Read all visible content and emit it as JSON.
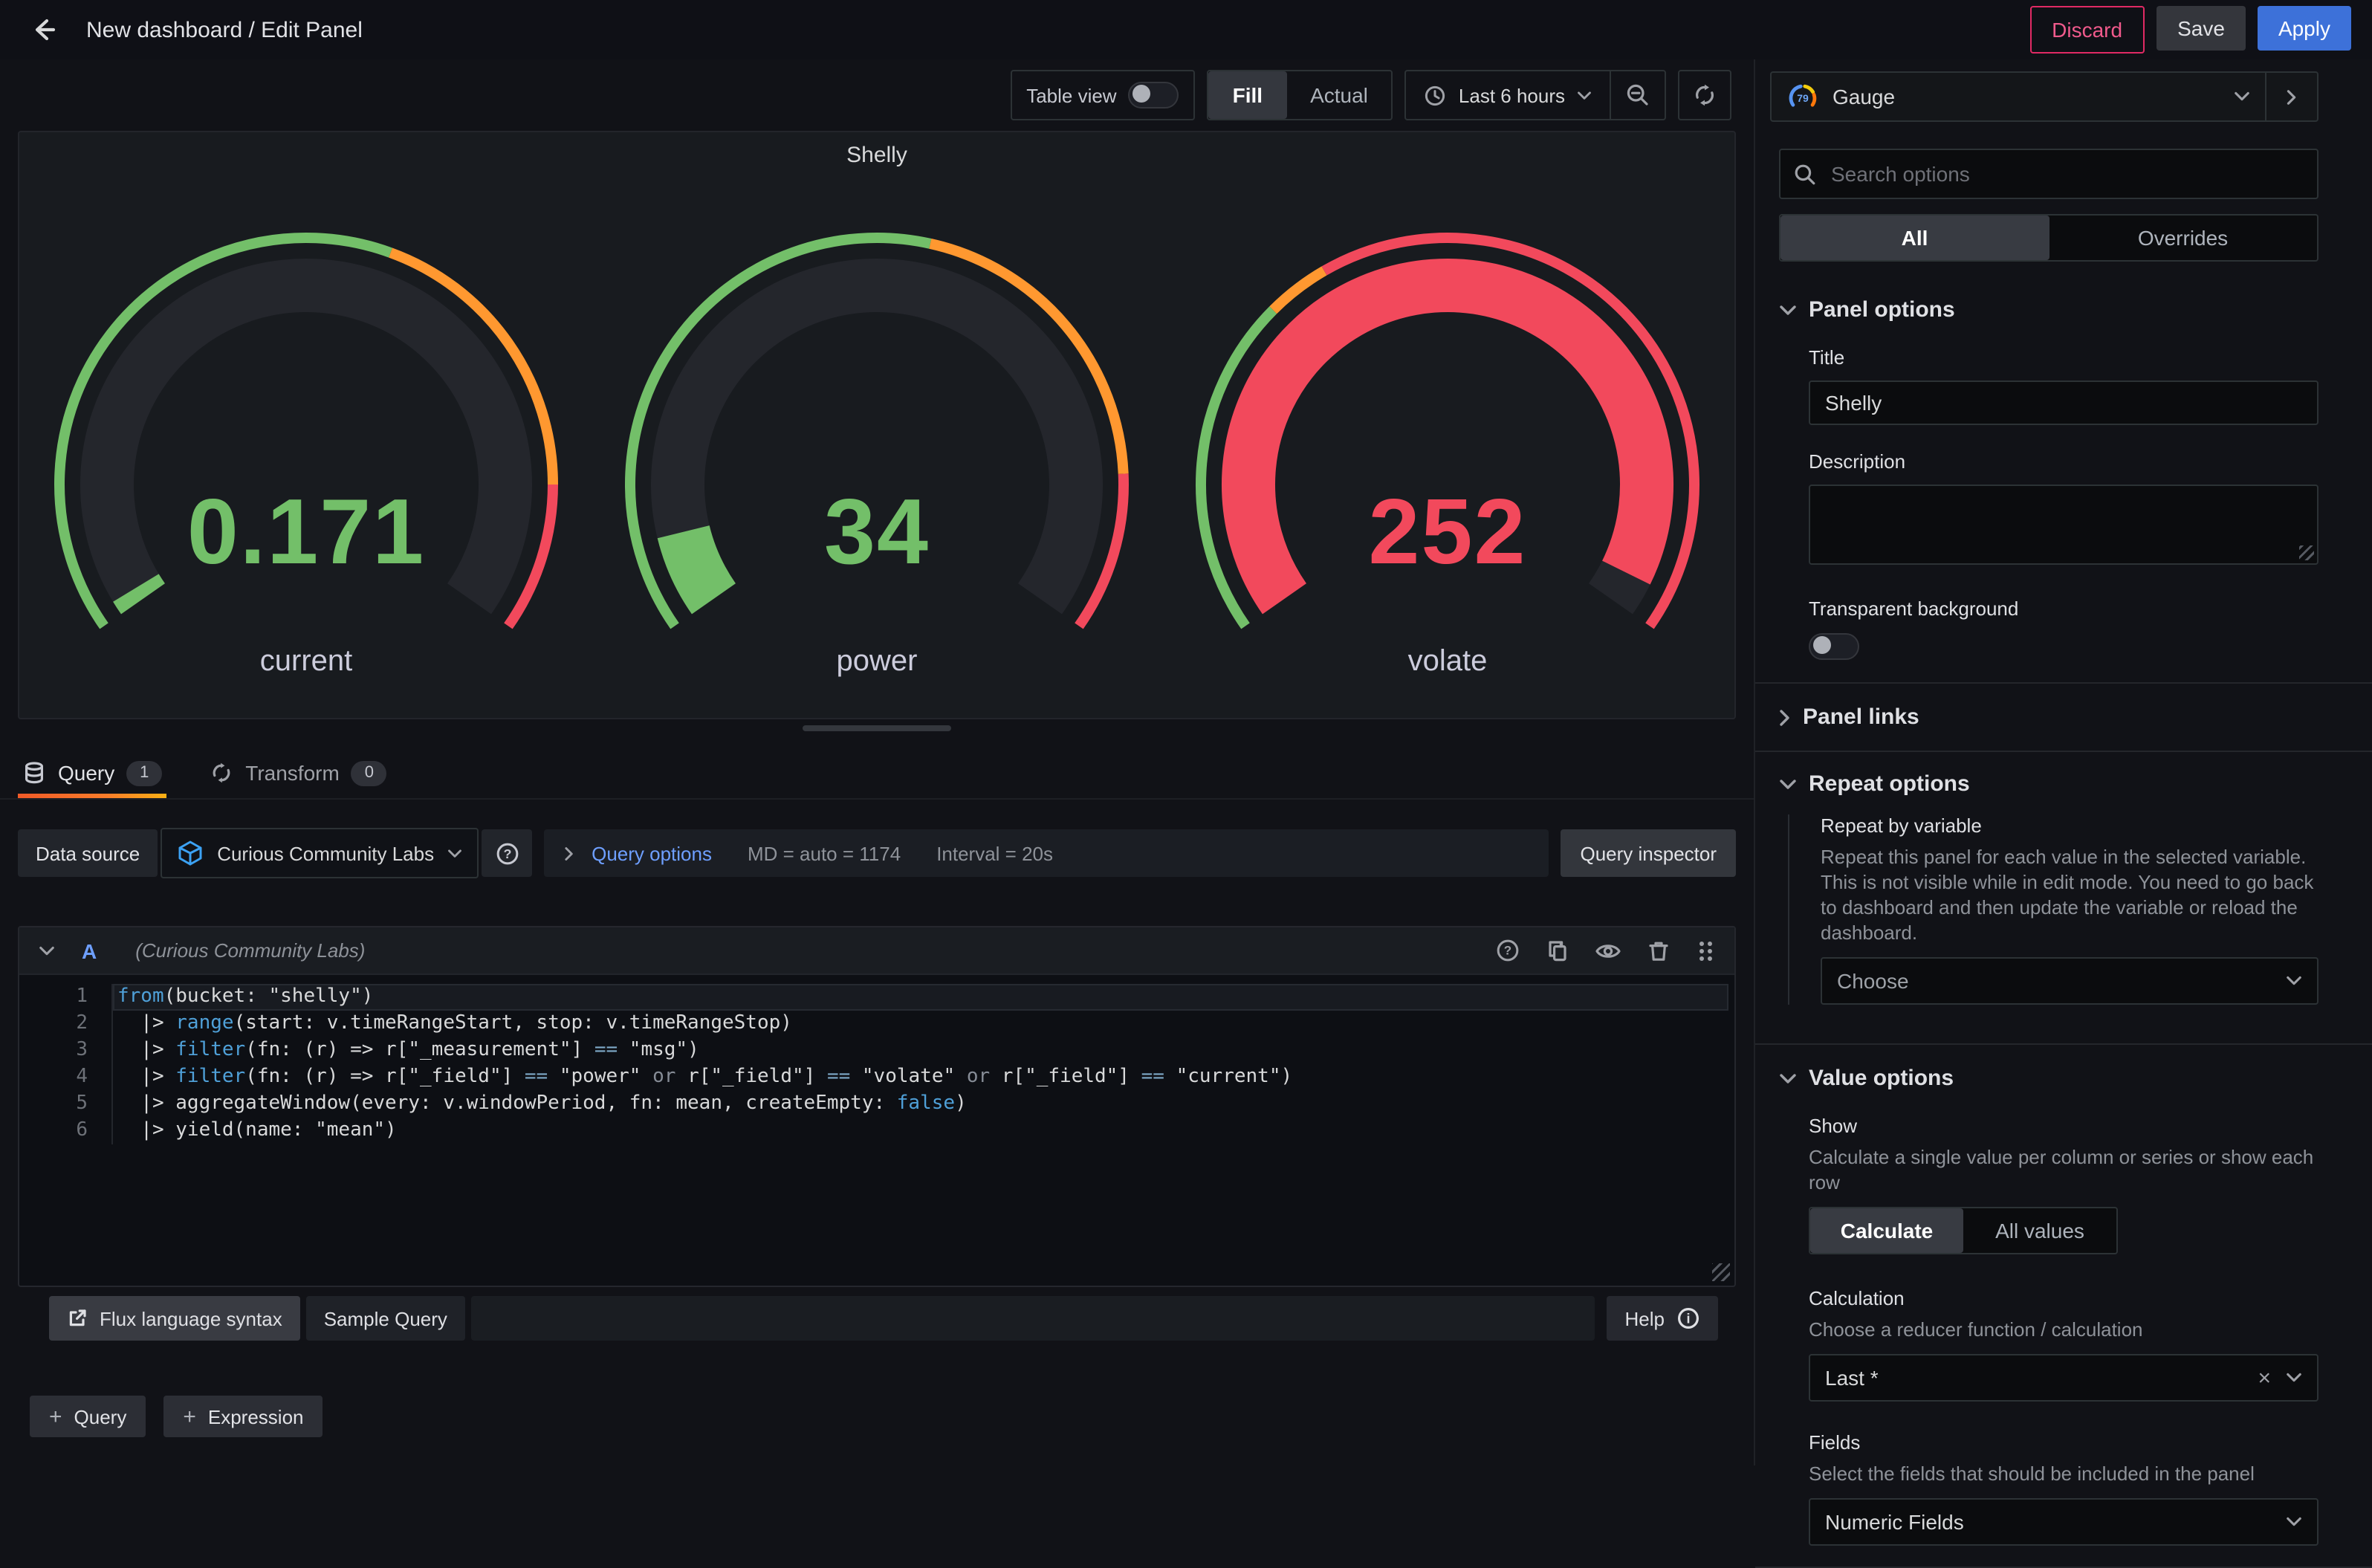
{
  "topbar": {
    "title": "New dashboard / Edit Panel",
    "discard_label": "Discard",
    "save_label": "Save",
    "apply_label": "Apply"
  },
  "viewport_toolbar": {
    "table_view_label": "Table view",
    "fill_label": "Fill",
    "actual_label": "Actual",
    "time_range_label": "Last 6 hours"
  },
  "colors": {
    "accent_blue": "#3d71d9",
    "link_blue": "#6e9fff",
    "success_green": "#73bf69",
    "warning_orange": "#ff9830",
    "critical_red": "#f2495c",
    "tab_underline_start": "#f05a28",
    "tab_underline_end": "#fbca0a"
  },
  "panel": {
    "title": "Shelly",
    "gauges": [
      {
        "label": "current",
        "value": "0.171",
        "color": "#73bf69",
        "fraction": 0.015,
        "ring": [
          {
            "to": 0.58,
            "color": "#73bf69"
          },
          {
            "to": 0.86,
            "color": "#ff9830"
          },
          {
            "to": 1,
            "color": "#f2495c"
          }
        ]
      },
      {
        "label": "power",
        "value": "34",
        "color": "#73bf69",
        "fraction": 0.085,
        "ring": [
          {
            "to": 0.55,
            "color": "#73bf69"
          },
          {
            "to": 0.85,
            "color": "#ff9830"
          },
          {
            "to": 1,
            "color": "#f2495c"
          }
        ]
      },
      {
        "label": "volate",
        "value": "252",
        "color": "#f2495c",
        "fraction": 0.965,
        "ring": [
          {
            "to": 0.32,
            "color": "#73bf69"
          },
          {
            "to": 0.38,
            "color": "#ff9830"
          },
          {
            "to": 1,
            "color": "#f2495c"
          }
        ]
      }
    ]
  },
  "query_section": {
    "tabs": [
      {
        "label": "Query",
        "count": "1"
      },
      {
        "label": "Transform",
        "count": "0"
      }
    ],
    "datasource_row": {
      "label": "Data source",
      "datasource_name": "Curious Community Labs",
      "query_options_label": "Query options",
      "md_info": "MD = auto = 1174",
      "interval_info": "Interval = 20s",
      "inspector_label": "Query inspector"
    },
    "query_card": {
      "ref_id": "A",
      "datasource_note": "(Curious Community Labs)"
    },
    "code": {
      "lines": [
        {
          "n": "1",
          "hl": true,
          "t": [
            [
              "kw",
              "from"
            ],
            [
              "pl",
              "(bucket: \"shelly\")"
            ]
          ]
        },
        {
          "n": "2",
          "hl": false,
          "t": [
            [
              "pl",
              "  |> "
            ],
            [
              "kw",
              "range"
            ],
            [
              "pl",
              "(start: v.timeRangeStart, stop: v.timeRangeStop)"
            ]
          ]
        },
        {
          "n": "3",
          "hl": false,
          "t": [
            [
              "pl",
              "  |> "
            ],
            [
              "kw",
              "filter"
            ],
            [
              "pl",
              "(fn: (r) => r[\"_measurement\"] "
            ],
            [
              "op",
              "=="
            ],
            [
              "pl",
              " \"msg\")"
            ]
          ]
        },
        {
          "n": "4",
          "hl": false,
          "t": [
            [
              "pl",
              "  |> "
            ],
            [
              "kw",
              "filter"
            ],
            [
              "pl",
              "(fn: (r) => r[\"_field\"] "
            ],
            [
              "op",
              "=="
            ],
            [
              "pl",
              " \"power\" "
            ],
            [
              "or",
              "or"
            ],
            [
              "pl",
              " r[\"_field\"] "
            ],
            [
              "op",
              "=="
            ],
            [
              "pl",
              " \"volate\" "
            ],
            [
              "or",
              "or"
            ],
            [
              "pl",
              " r[\"_field\"] "
            ],
            [
              "op",
              "=="
            ],
            [
              "pl",
              " \"current\")"
            ]
          ]
        },
        {
          "n": "5",
          "hl": false,
          "t": [
            [
              "pl",
              "  |> aggregateWindow(every: v.windowPeriod, fn: mean, createEmpty: "
            ],
            [
              "kw",
              "false"
            ],
            [
              "pl",
              ")"
            ]
          ]
        },
        {
          "n": "6",
          "hl": false,
          "t": [
            [
              "pl",
              "  |> yield(name: \"mean\")"
            ]
          ]
        }
      ]
    },
    "footer": {
      "flux_label": "Flux language syntax",
      "sample_label": "Sample Query",
      "help_label": "Help"
    },
    "add_query_label": "Query",
    "add_expression_label": "Expression"
  },
  "sidebar": {
    "viz_label": "Gauge",
    "viz_icon_value": "79",
    "search_placeholder": "Search options",
    "filter_tabs": {
      "all": "All",
      "overrides": "Overrides"
    },
    "panel_options": {
      "heading": "Panel options",
      "title_label": "Title",
      "title_value": "Shelly",
      "description_label": "Description",
      "transparent_label": "Transparent background"
    },
    "panel_links": {
      "heading": "Panel links"
    },
    "repeat_options": {
      "heading": "Repeat options",
      "repeat_label": "Repeat by variable",
      "repeat_desc": "Repeat this panel for each value in the selected variable. This is not visible while in edit mode. You need to go back to dashboard and then update the variable or reload the dashboard.",
      "choose_placeholder": "Choose"
    },
    "value_options": {
      "heading": "Value options",
      "show_label": "Show",
      "show_desc": "Calculate a single value per column or series or show each row",
      "calculate_tab": "Calculate",
      "all_values_tab": "All values",
      "calculation_label": "Calculation",
      "calculation_desc": "Choose a reducer function / calculation",
      "calculation_value": "Last *",
      "fields_label": "Fields",
      "fields_desc": "Select the fields that should be included in the panel",
      "fields_value": "Numeric Fields"
    }
  }
}
